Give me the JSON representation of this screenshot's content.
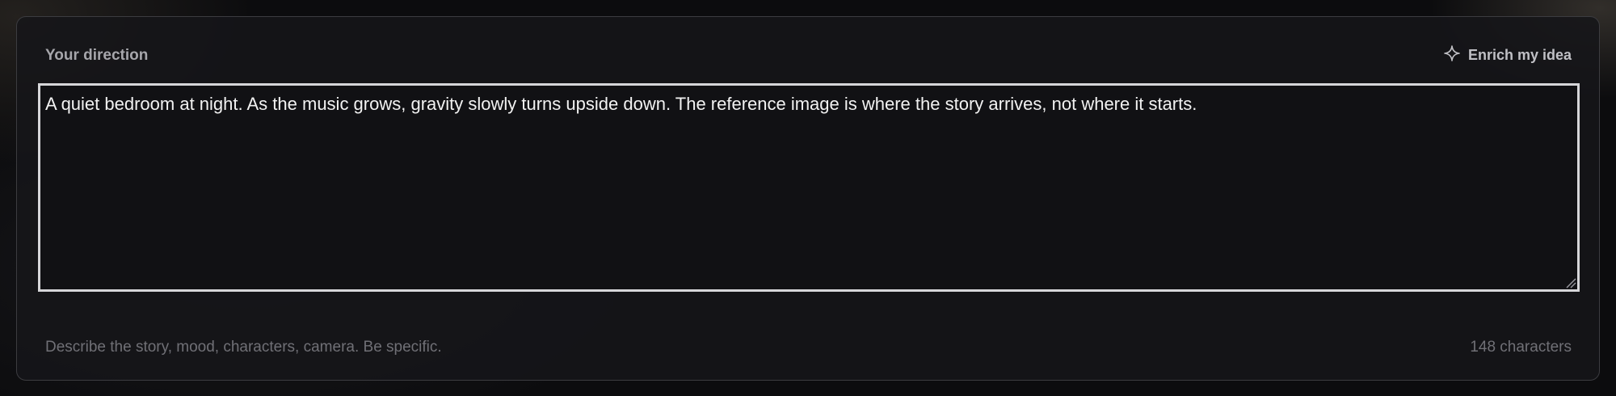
{
  "panel": {
    "label": "Your direction",
    "enrich_label": "Enrich my idea",
    "enrich_icon": "sparkle-icon",
    "textarea_value": "A quiet bedroom at night. As the music grows, gravity slowly turns upside down. The reference image is where the story arrives, not where it starts.",
    "hint": "Describe the story, mood, characters, camera. Be specific.",
    "char_count": "148 characters"
  },
  "colors": {
    "background": "#0c0c0e",
    "panel_border": "#3c3c40",
    "textarea_border": "#d6d6d9",
    "label_text": "#a6a6ab",
    "muted_text": "#707076"
  }
}
